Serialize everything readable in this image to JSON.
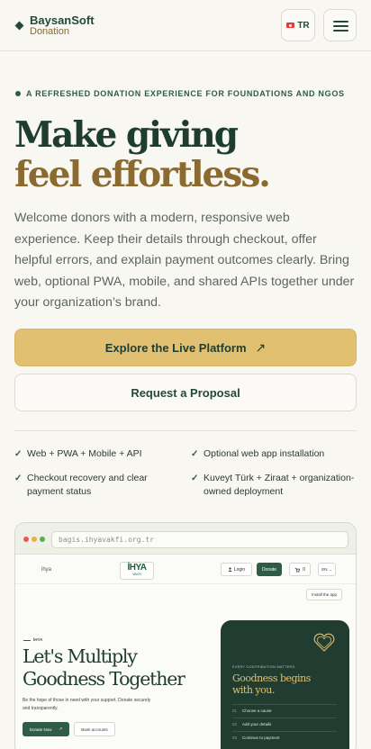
{
  "header": {
    "brand_name": "BaysanSoft",
    "brand_sub": "Donation",
    "lang_label": "TR"
  },
  "hero": {
    "eyebrow": "A REFRESHED DONATION EXPERIENCE FOR FOUNDATIONS AND NGOS",
    "title_line1": "Make giving",
    "title_line2": "feel effortless.",
    "lead": "Welcome donors with a modern, responsive web experience. Keep their details through checkout, offer helpful errors, and explain payment outcomes clearly. Bring web, optional PWA, mobile, and shared APIs together under your organization’s brand.",
    "primary_cta": "Explore the Live Platform",
    "primary_cta_icon": "↗",
    "secondary_cta": "Request a Proposal"
  },
  "features": [
    "Web + PWA + Mobile + API",
    "Optional web app installation",
    "Checkout recovery and clear payment status",
    "Kuveyt Türk + Ziraat + organization-owned deployment"
  ],
  "preview": {
    "url": "bagis.ihyavakfi.org.tr",
    "site": {
      "nav_left": "ihya",
      "logo_main": "İHYA",
      "logo_sub": "VAKFI",
      "login": "Login",
      "donate": "Donate",
      "cart_count": "0",
      "lang": "EN",
      "install": "Install the app",
      "tag": "İHYA",
      "heading_line1": "Let's Multiply",
      "heading_line2": "Goodness Together",
      "subtext": "Be the hope of those in need with your support. Donate securely and transparently.",
      "donate_now": "Donate Now",
      "donate_now_icon": "↗",
      "bank_accounts": "Bank accounts",
      "card": {
        "eyebrow": "EVERY CONTRIBUTION MATTERS",
        "title_line1": "Goodness begins",
        "title_line2": "with you.",
        "steps": [
          {
            "num": "01",
            "label": "Choose a cause"
          },
          {
            "num": "02",
            "label": "Add your details"
          },
          {
            "num": "03",
            "label": "Continue to payment"
          }
        ]
      }
    }
  },
  "colors": {
    "brand_green": "#24483a",
    "accent_gold": "#e2c071",
    "heading_gold": "#8a6a2f",
    "background": "#f8f7f2"
  },
  "icons": {
    "menu": "hamburger-icon",
    "flag": "turkey-flag-icon",
    "check": "check-icon",
    "external": "arrow-up-right-icon",
    "heart": "heart-icon",
    "cart": "cart-icon"
  }
}
